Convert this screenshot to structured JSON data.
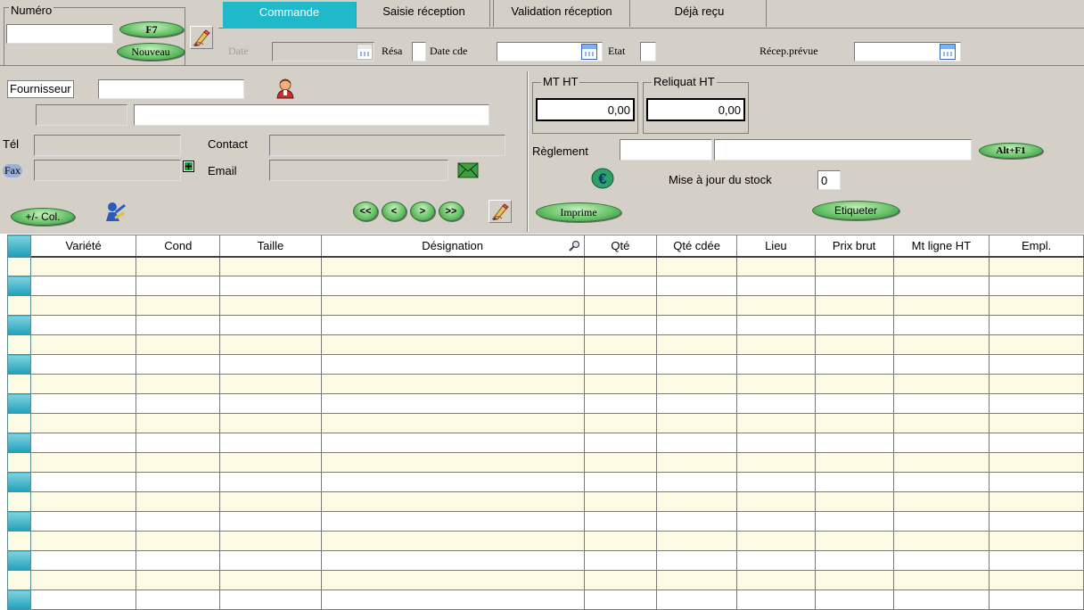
{
  "header": {
    "numero_label": "Numéro",
    "numero_value": "",
    "f7_label": "F7",
    "nouveau_label": "Nouveau",
    "tabs": [
      {
        "label": "Commande",
        "active": true
      },
      {
        "label": "Saisie réception",
        "active": false
      },
      {
        "label": "Validation réception",
        "active": false
      },
      {
        "label": "Déjà reçu",
        "active": false
      }
    ],
    "date_label": "Date",
    "date_value": "",
    "resa_label": "Résa",
    "date_cde_label": "Date cde",
    "date_cde_value": "",
    "etat_label": "Etat",
    "recep_prevue_label": "Récep.prévue",
    "recep_prevue_value": ""
  },
  "supplier": {
    "fournisseur_label": "Fournisseur",
    "fournisseur_code": "",
    "code2": "",
    "name": "",
    "tel_label": "Tél",
    "tel_value": "",
    "contact_label": "Contact",
    "contact_value": "",
    "fax_label": "Fax",
    "fax_value": "",
    "email_label": "Email",
    "email_value": "",
    "col_button": "+/- Col.",
    "nav": [
      "<<",
      "<",
      ">",
      ">>"
    ]
  },
  "totals": {
    "mt_ht_label": "MT HT",
    "mt_ht_value": "0,00",
    "reliquat_label": "Reliquat HT",
    "reliquat_value": "0,00",
    "reglement_label": "Règlement",
    "reglement_code": "",
    "reglement_text": "",
    "altf1_label": "Alt+F1",
    "stock_label": "Mise à jour du stock",
    "stock_value": "0",
    "imprime_label": "Imprime",
    "etiqueter_label": "Etiqueter"
  },
  "grid": {
    "columns": [
      "Variété",
      "Cond",
      "Taille",
      "Désignation",
      "Qté",
      "Qté cdée",
      "Lieu",
      "Prix brut",
      "Mt ligne HT",
      "Empl."
    ],
    "row_count": 19
  },
  "colors": {
    "window_bg": "#d4d0c8",
    "active_tab": "#1fb9c9",
    "pill_green": "#6cc46c",
    "alt_row": "#fdfbe4"
  },
  "icons": [
    "edit-pencil-icon",
    "calendar-icon",
    "supplier-person-icon",
    "add-fax-icon",
    "email-envelope-icon",
    "euro-icon",
    "column-person-icon",
    "search-magnifier-icon"
  ]
}
